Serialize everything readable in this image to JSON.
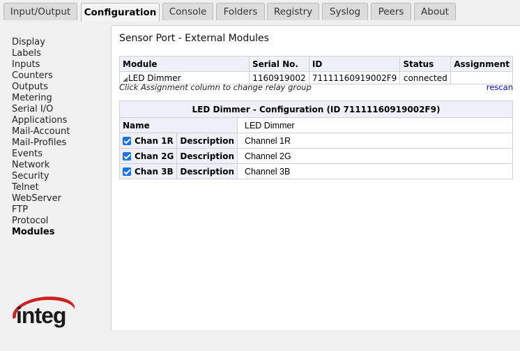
{
  "tabs": [
    {
      "label": "Input/Output",
      "active": false
    },
    {
      "label": "Configuration",
      "active": true
    },
    {
      "label": "Console",
      "active": false
    },
    {
      "label": "Folders",
      "active": false
    },
    {
      "label": "Registry",
      "active": false
    },
    {
      "label": "Syslog",
      "active": false
    },
    {
      "label": "Peers",
      "active": false
    },
    {
      "label": "About",
      "active": false
    }
  ],
  "sidebar": {
    "items": [
      {
        "label": "Display"
      },
      {
        "label": "Labels"
      },
      {
        "label": "Inputs"
      },
      {
        "label": "Counters"
      },
      {
        "label": "Outputs"
      },
      {
        "label": "Metering"
      },
      {
        "label": "Serial I/O"
      },
      {
        "label": "Applications"
      },
      {
        "label": "Mail-Account"
      },
      {
        "label": "Mail-Profiles"
      },
      {
        "label": "Events"
      },
      {
        "label": "Network"
      },
      {
        "label": "Security"
      },
      {
        "label": "Telnet"
      },
      {
        "label": "WebServer"
      },
      {
        "label": "FTP"
      },
      {
        "label": "Protocol"
      },
      {
        "label": "Modules",
        "active": true
      }
    ],
    "logo_text": "integ",
    "logo_color": "#cc2222"
  },
  "main": {
    "title": "Sensor Port - External Modules",
    "modules_table": {
      "headers": [
        "Module",
        "Serial No.",
        "ID",
        "Status",
        "Assignment"
      ],
      "rows": [
        {
          "module": "LED Dimmer",
          "serial": "1160919002",
          "id": "71111160919002F9",
          "status": "connected",
          "assignment": ""
        }
      ]
    },
    "hint": "Click Assignment column to change relay group",
    "rescan_label": "rescan",
    "config": {
      "caption": "LED Dimmer - Configuration (ID 71111160919002F9)",
      "name_label": "Name",
      "name_value": "LED Dimmer",
      "channels": [
        {
          "label": "Chan 1R",
          "checked": true,
          "desc_label": "Description",
          "desc_value": "Channel 1R"
        },
        {
          "label": "Chan 2G",
          "checked": true,
          "desc_label": "Description",
          "desc_value": "Channel 2G"
        },
        {
          "label": "Chan 3B",
          "checked": true,
          "desc_label": "Description",
          "desc_value": "Channel 3B"
        }
      ]
    }
  },
  "colors": {
    "checkbox": "#1a73e8",
    "link": "#0000cc",
    "header_bg": "#eef2f8"
  }
}
